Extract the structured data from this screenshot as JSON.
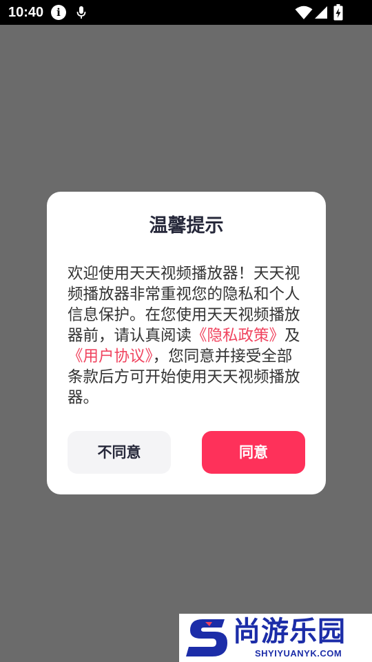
{
  "status_bar": {
    "time": "10:40",
    "info_icon_glyph": "i",
    "icons": [
      "info-icon",
      "microphone-icon",
      "wifi-icon",
      "cell-signal-icon",
      "battery-charging-icon"
    ]
  },
  "dialog": {
    "title": "温馨提示",
    "message": {
      "part1": "欢迎使用天天视频播放器！天天视频播放器非常重视您的隐私和个人信息保护。在您使用天天视频播放器前，请认真阅读",
      "privacy_link": "《隐私政策》",
      "part2": "及",
      "agreement_link": "《用户协议》",
      "part3": "，您同意并接受全部条款后方可开始使用天天视频播放器。"
    },
    "disagree_label": "不同意",
    "agree_label": "同意"
  },
  "watermark": {
    "name": "尚游乐园",
    "url": "SHYIYUANYK.COM"
  },
  "colors": {
    "overlay": "#6b6b6b",
    "accent": "#fe315a",
    "link": "#f0445f",
    "title": "#26283a",
    "watermark_blue": "#1c2da8"
  }
}
